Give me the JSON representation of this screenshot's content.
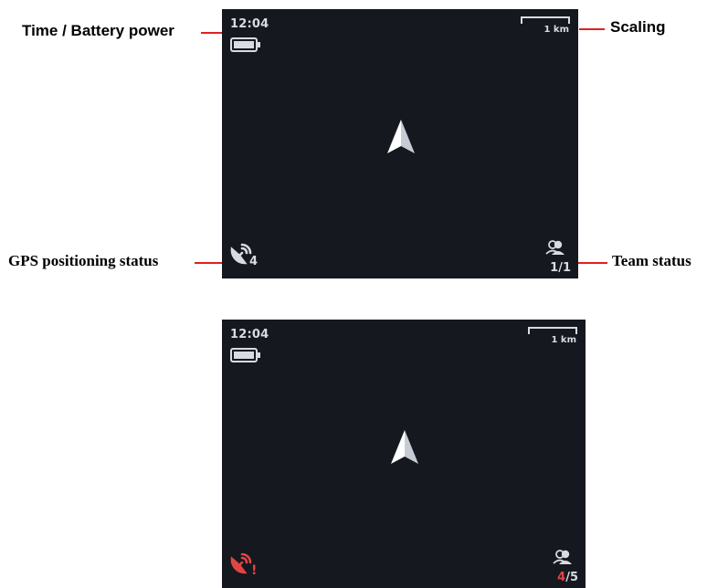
{
  "annotations": {
    "time_battery": "Time / Battery power",
    "scaling": "Scaling",
    "gps_status": "GPS positioning status",
    "team_status": "Team status"
  },
  "screen_normal": {
    "time": "12:04",
    "scale_label": "1 km",
    "gps_satellites": "4",
    "team_online": "1",
    "team_separator": "/",
    "team_total": "1"
  },
  "screen_warning": {
    "time": "12:04",
    "scale_label": "1 km",
    "gps_alert": "!",
    "team_online": "4",
    "team_separator": "/",
    "team_total": "5"
  },
  "colors": {
    "screen_bg": "#15181f",
    "foreground": "#d8dbe2",
    "alert": "#e04545",
    "leader_line": "#e02020"
  },
  "icons": [
    "battery-icon",
    "scale-bar-icon",
    "heading-arrow-icon",
    "gps-satellite-icon",
    "team-member-icon"
  ]
}
